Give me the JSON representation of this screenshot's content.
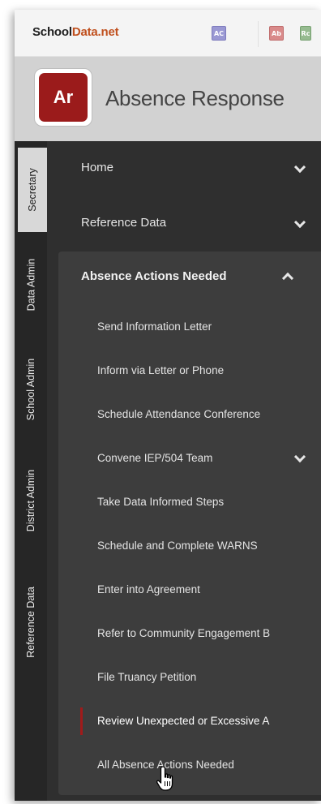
{
  "topbar": {
    "brand_part1": "School",
    "brand_part2": "Data.net",
    "app_chips": [
      {
        "label": "AC",
        "color": "#9a98d3"
      },
      {
        "label": "Ab",
        "color": "#d98a8a"
      },
      {
        "label": "Rc",
        "color": "#96bb90"
      }
    ]
  },
  "header": {
    "logo_text": "Ar",
    "logo_color": "#9b1b1b",
    "title": "Absence Response"
  },
  "role_tabs": [
    {
      "label": "Secretary",
      "active": true
    },
    {
      "label": "Data Admin",
      "active": false
    },
    {
      "label": "School Admin",
      "active": false
    },
    {
      "label": "District Admin",
      "active": false
    },
    {
      "label": "Reference Data",
      "active": false
    }
  ],
  "nav": {
    "items": [
      {
        "label": "Home",
        "icon": "chevron-down-icon"
      },
      {
        "label": "Reference Data",
        "icon": "chevron-down-icon"
      }
    ],
    "section": {
      "title": "Absence Actions Needed",
      "icon": "chevron-up-icon",
      "items": [
        {
          "label": "Send Information Letter"
        },
        {
          "label": "Inform via Letter or Phone"
        },
        {
          "label": "Schedule Attendance Conference"
        },
        {
          "label": "Convene IEP/504 Team",
          "icon": "chevron-down-icon"
        },
        {
          "label": "Take Data Informed Steps"
        },
        {
          "label": "Schedule and Complete WARNS"
        },
        {
          "label": "Enter into Agreement"
        },
        {
          "label": "Refer to Community Engagement B"
        },
        {
          "label": "File Truancy Petition"
        },
        {
          "label": "Review Unexpected or Excessive A",
          "active": true
        },
        {
          "label": "All Absence Actions Needed"
        }
      ]
    }
  },
  "accent_color": "#a11a1a"
}
